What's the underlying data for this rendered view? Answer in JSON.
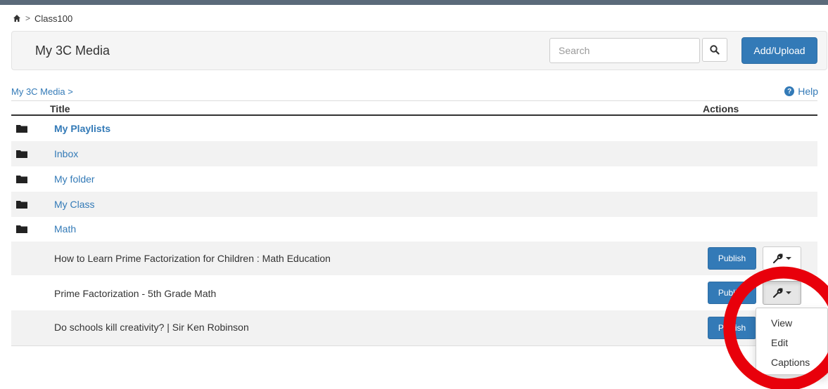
{
  "breadcrumb": {
    "current": "Class100",
    "separator": ">"
  },
  "header": {
    "title": "My 3C Media",
    "add_label": "Add/Upload"
  },
  "search": {
    "placeholder": "Search"
  },
  "path": {
    "label": "My 3C Media",
    "separator": ">"
  },
  "help": {
    "label": "Help",
    "icon": "question-circle-icon"
  },
  "table": {
    "col_title": "Title",
    "col_actions": "Actions",
    "folders": [
      {
        "name": "My Playlists"
      },
      {
        "name": "Inbox"
      },
      {
        "name": "My folder"
      },
      {
        "name": "My Class"
      },
      {
        "name": "Math"
      }
    ],
    "media": [
      {
        "title": "How to Learn Prime Factorization for Children : Math Education",
        "publish_label": "Publish"
      },
      {
        "title": "Prime Factorization - 5th Grade Math",
        "publish_label": "Publish"
      },
      {
        "title": "Do schools kill creativity? | Sir Ken Robinson",
        "publish_label": "Publish"
      }
    ]
  },
  "dropdown_menu": {
    "items": [
      "View",
      "Edit",
      "Captions"
    ]
  },
  "colors": {
    "primary": "#337ab7",
    "stripe": "#f2f2f2",
    "annotation": "#e8000b",
    "topbar": "#5b6a7a"
  }
}
